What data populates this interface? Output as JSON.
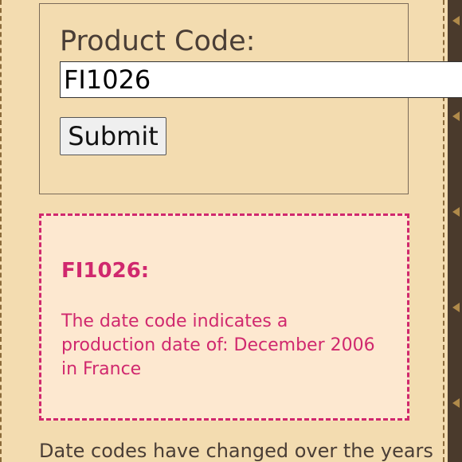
{
  "form": {
    "label": "Product Code:",
    "input_value": "FI1026",
    "submit_label": "Submit"
  },
  "result": {
    "code_heading": "FI1026:",
    "line1": "The date code indicates a",
    "line2": "production date of: December 2006",
    "line3": "in France"
  },
  "footer": {
    "text": "Date codes have changed over the years"
  },
  "colors": {
    "page_background": "#f3dcb0",
    "accent_pink": "#d0286e",
    "result_background": "#fde8d0",
    "text_brown": "#4a3e36"
  }
}
